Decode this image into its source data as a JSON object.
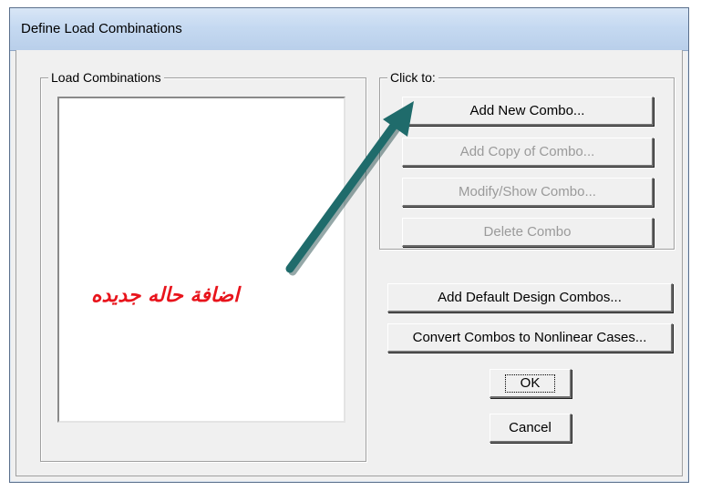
{
  "window": {
    "title": "Define Load Combinations"
  },
  "load_combinations": {
    "legend": "Load Combinations",
    "items": []
  },
  "click_to": {
    "legend": "Click to:",
    "add_new_combo": "Add New Combo...",
    "add_copy_of_combo": "Add Copy of Combo...",
    "modify_show_combo": "Modify/Show Combo...",
    "delete_combo": "Delete Combo"
  },
  "buttons": {
    "add_default_design_combos": "Add Default Design Combos...",
    "convert_combos": "Convert Combos to Nonlinear Cases...",
    "ok": "OK",
    "cancel": "Cancel"
  },
  "annotation": {
    "text": "اضافة حاله جديده",
    "color": "#e8141c",
    "arrow_color": "#1f6b6b"
  }
}
